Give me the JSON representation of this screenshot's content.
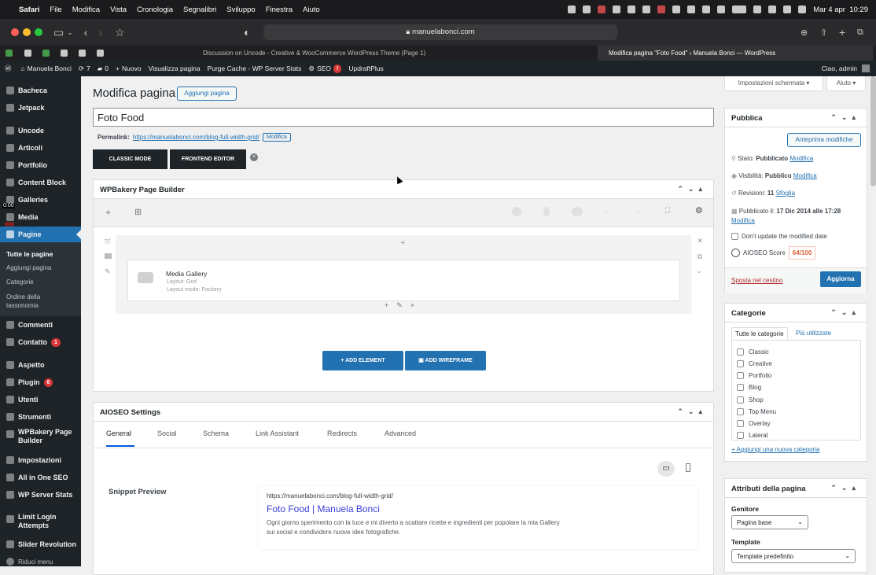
{
  "macos": {
    "app": "Safari",
    "menus": [
      "File",
      "Modifica",
      "Vista",
      "Cronologia",
      "Segnalibri",
      "Sviluppo",
      "Finestra",
      "Aiuto"
    ],
    "clock": "Mar 4 apr  10:29"
  },
  "browser": {
    "url": "manuelabonci.com",
    "tabs": [
      {
        "label": "Discussion on Uncode - Creative & WooCommerce WordPress Theme (Page 1)"
      },
      {
        "label": "Modifica pagina \"Foto Food\" ‹ Manuela Bonci — WordPress"
      }
    ]
  },
  "adminbar": {
    "site": "Manuela Bonci",
    "updates": "7",
    "comments": "0",
    "new": "Nuovo",
    "view": "Visualizza pagina",
    "purge": "Purge Cache - WP Server Stats",
    "seo": "SEO",
    "seo_badge": "!",
    "updraft": "UpdraftPlus",
    "greeting": "Ciao, admin"
  },
  "sidebar": {
    "items": [
      {
        "label": "Bacheca"
      },
      {
        "label": "Jetpack"
      },
      {
        "label": "Uncode"
      },
      {
        "label": "Articoli"
      },
      {
        "label": "Portfolio"
      },
      {
        "label": "Content Block"
      },
      {
        "label": "Galleries"
      },
      {
        "label": "Media"
      },
      {
        "label": "Pagine"
      },
      {
        "label": "Commenti"
      },
      {
        "label": "Contatto",
        "badge": "1"
      },
      {
        "label": "Aspetto"
      },
      {
        "label": "Plugin",
        "badge": "6"
      },
      {
        "label": "Utenti"
      },
      {
        "label": "Strumenti"
      },
      {
        "label": "WPBakery Page Builder"
      },
      {
        "label": "Impostazioni"
      },
      {
        "label": "All in One SEO"
      },
      {
        "label": "WP Server Stats"
      },
      {
        "label": "Limit Login Attempts"
      },
      {
        "label": "Slider Revolution"
      },
      {
        "label": "Riduci menu"
      }
    ],
    "submenu": [
      "Tutte le pagine",
      "Aggiungi pagina",
      "Categorie",
      "Ordine della tassonomia"
    ],
    "overlay_time": "0:00"
  },
  "screen_options": "Impostazioni schermata",
  "help": "Aiuto",
  "page": {
    "heading": "Modifica pagina",
    "add_new": "Aggiungi pagina",
    "title_value": "Foto Food",
    "permalink_label": "Permalink:",
    "permalink_url": "https://manuelabonci.com/blog-full-width-grid/",
    "permalink_edit": "Modifica",
    "classic_mode": "CLASSIC MODE",
    "frontend_editor": "FRONTEND EDITOR"
  },
  "wpbakery": {
    "title": "WPBakery Page Builder",
    "element_name": "Media Gallery",
    "element_layout": "Layout: Grid",
    "element_layout_mode": "Layout mode: Packery",
    "add_element": "ADD ELEMENT",
    "add_wireframe": "ADD WIREFRAME"
  },
  "aioseo": {
    "title": "AIOSEO Settings",
    "tabs": [
      "General",
      "Social",
      "Schema",
      "Link Assistant",
      "Redirects",
      "Advanced"
    ],
    "snippet_label": "Snippet Preview",
    "snippet_url": "https://manuelabonci.com/blog-full-width-grid/",
    "snippet_title": "Foto Food | Manuela Bonci",
    "snippet_desc": "Ogni giorno sperimento con la luce e mi diverto a scattare ricette e ingredienti per popolare la mia Gallery sui social e condividere nuove idee fotografiche."
  },
  "publish": {
    "title": "Pubblica",
    "preview": "Anteprima modifiche",
    "status_label": "Stato:",
    "status_value": "Pubblicato",
    "status_edit": "Modifica",
    "visibility_label": "Visibilità:",
    "visibility_value": "Pubblico",
    "visibility_edit": "Modifica",
    "revisions_label": "Revisioni:",
    "revisions_value": "11",
    "revisions_link": "Sfoglia",
    "published_label": "Pubblicato il:",
    "published_value": "17 Dic 2014 alle 17:28",
    "published_edit": "Modifica",
    "dont_update": "Don't update the modified date",
    "aioseo_score_label": "AIOSEO Score",
    "aioseo_score": "64/100",
    "trash": "Sposta nel cestino",
    "update": "Aggiorna"
  },
  "categories": {
    "title": "Categorie",
    "tab_all": "Tutte le categorie",
    "tab_most": "Più utilizzate",
    "items": [
      "Classic",
      "Creative",
      "Portfolio",
      "Blog",
      "Shop",
      "Top Menu",
      "Overlay",
      "Lateral"
    ],
    "add_new": "+ Aggiungi una nuova categoria"
  },
  "attributes": {
    "title": "Attributi della pagina",
    "parent_label": "Genitore",
    "parent_value": "Pagina base",
    "template_label": "Template",
    "template_value": "Template predefinito"
  },
  "colors": {
    "accent": "#2271b1",
    "admin_dark": "#1d2327",
    "danger": "#d63638",
    "score": "#e0603c"
  }
}
